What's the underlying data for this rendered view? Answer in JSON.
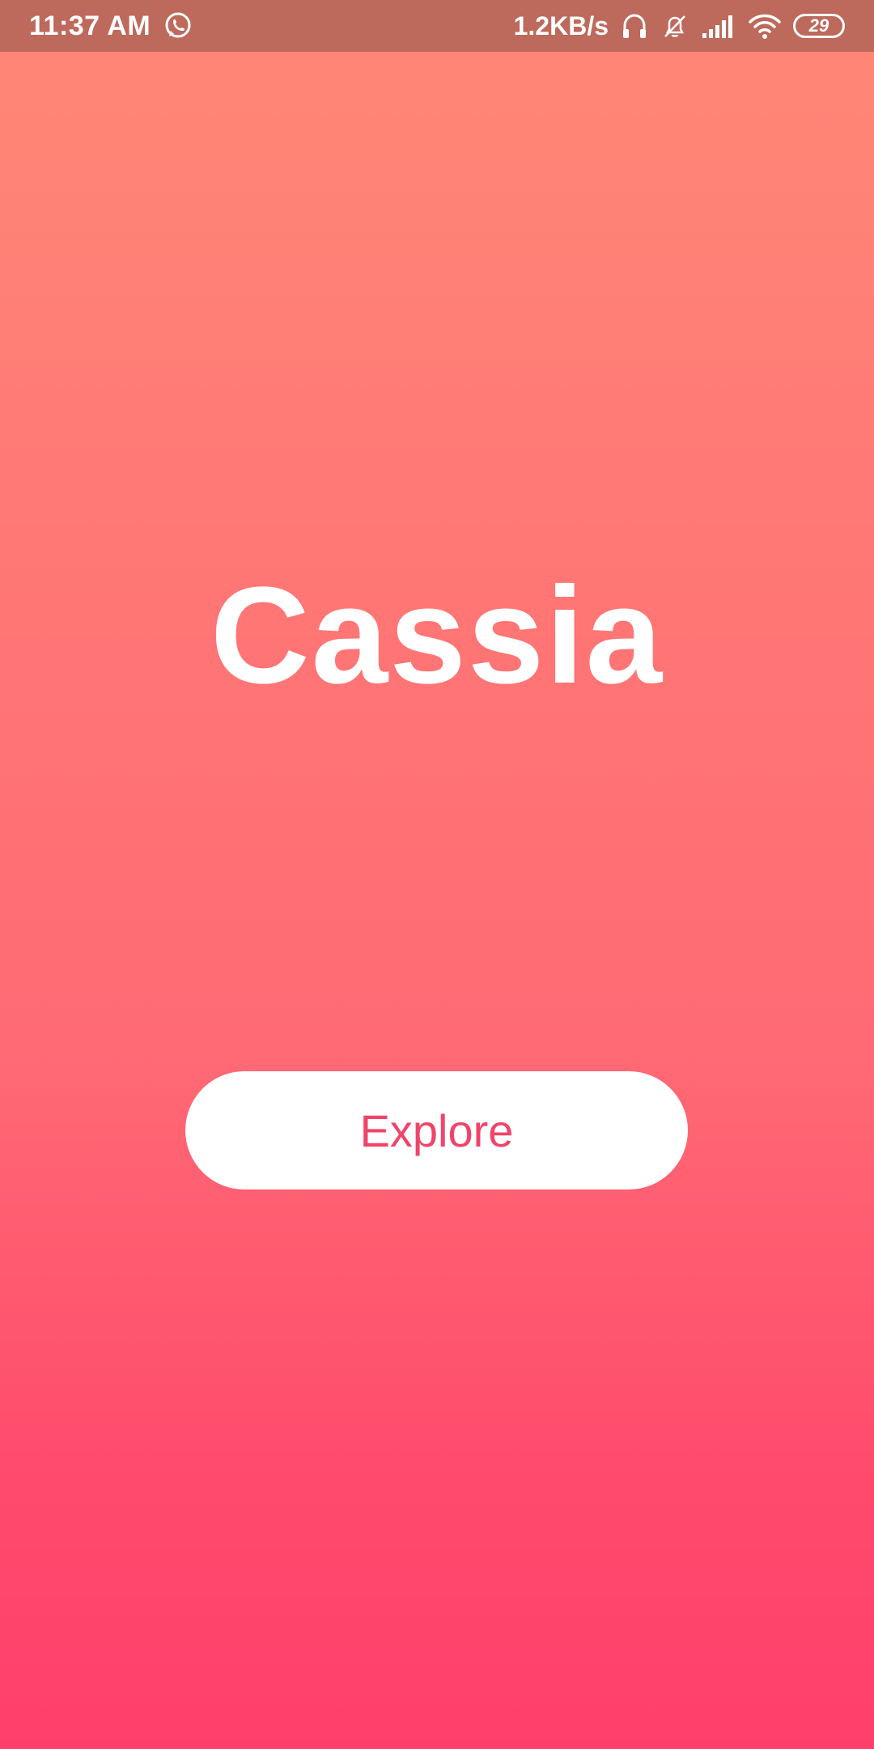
{
  "status_bar": {
    "time": "11:37 AM",
    "net_speed": "1.2KB/s",
    "battery_level": "29",
    "icons": [
      "whatsapp-icon",
      "headphones-icon",
      "bell-off-icon",
      "signal-icon",
      "wifi-icon",
      "battery-icon"
    ]
  },
  "main": {
    "app_title": "Cassia",
    "explore_label": "Explore"
  },
  "colors": {
    "status_bar_bg": "#bd695c",
    "gradient_top": "#ff8877",
    "gradient_bottom": "#ff3f6b",
    "button_text": "#f0446a",
    "button_bg": "#ffffff"
  }
}
